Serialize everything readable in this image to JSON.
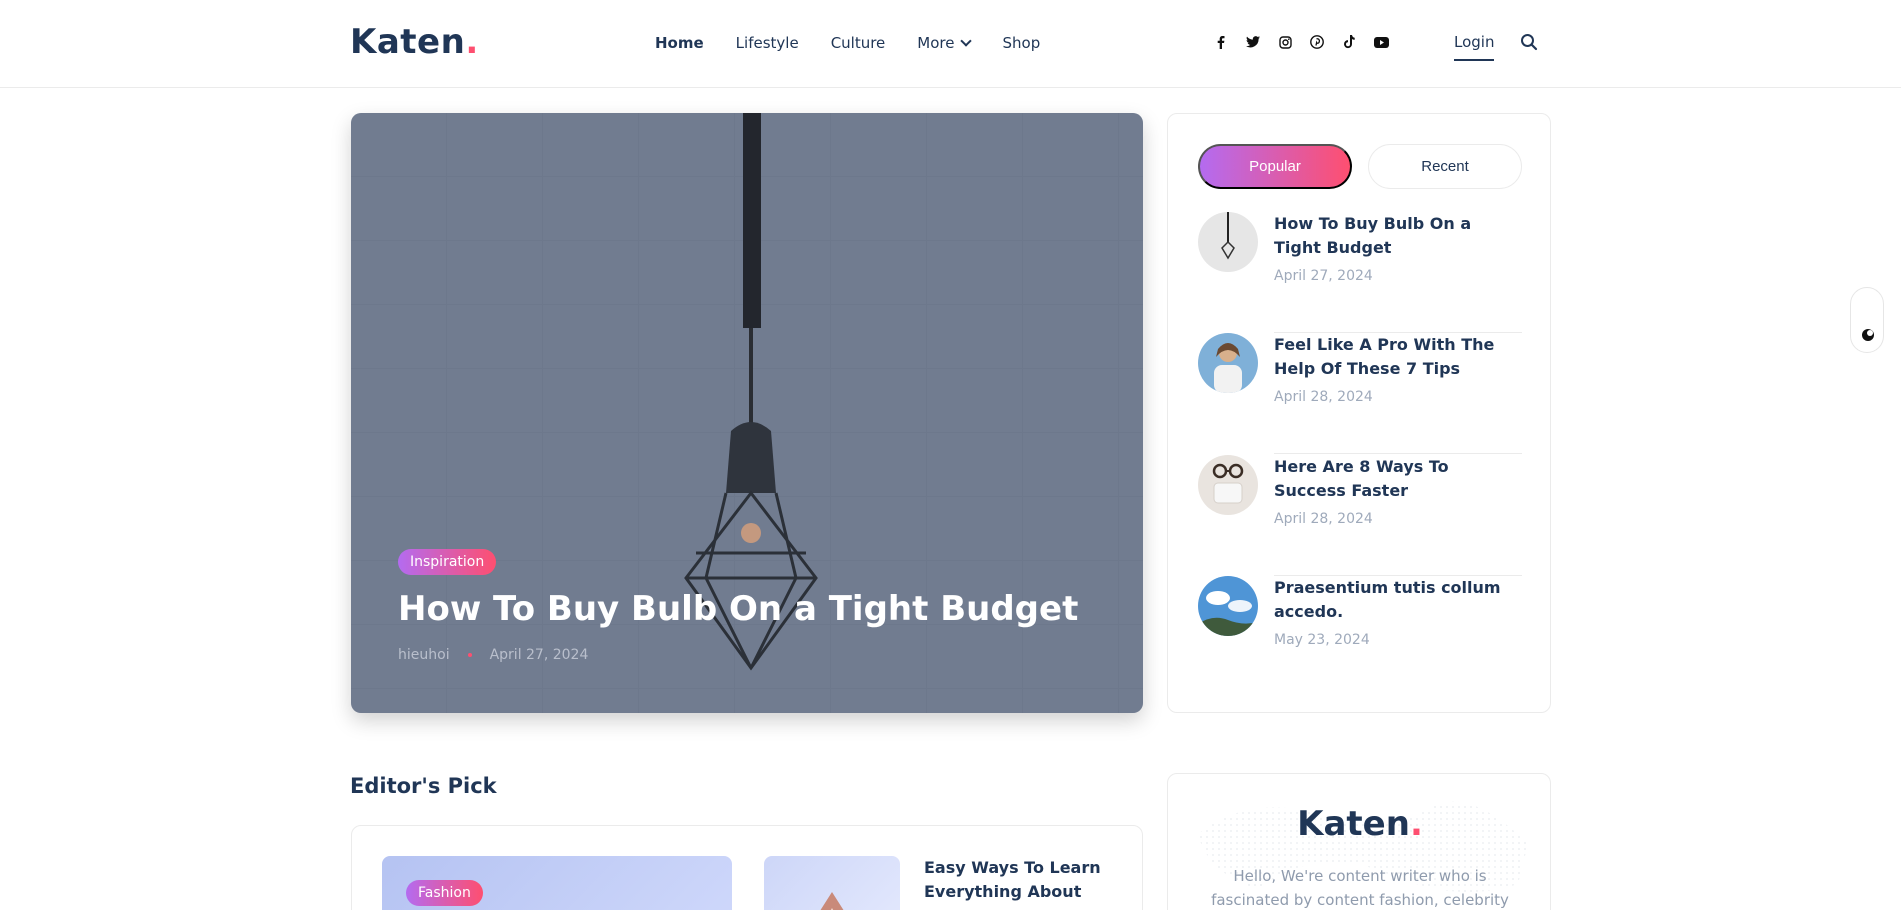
{
  "header": {
    "logo_text": "Katen",
    "logo_dot": ".",
    "nav": [
      "Home",
      "Lifestyle",
      "Culture",
      "More",
      "Shop"
    ],
    "social_icons": [
      "facebook-icon",
      "twitter-icon",
      "instagram-icon",
      "pinterest-icon",
      "tiktok-icon",
      "youtube-icon"
    ],
    "login_label": "Login"
  },
  "hero": {
    "category": "Inspiration",
    "title": "How To Buy Bulb On a Tight Budget",
    "author": "hieuhoi",
    "date": "April 27, 2024"
  },
  "sidebar": {
    "tabs": [
      "Popular",
      "Recent"
    ],
    "active_tab": "Popular",
    "posts": [
      {
        "title": "How To Buy Bulb On a Tight Budget",
        "date": "April 27, 2024"
      },
      {
        "title": "Feel Like A Pro With The Help Of These 7 Tips",
        "date": "April 28, 2024"
      },
      {
        "title": "Here Are 8 Ways To Success Faster",
        "date": "April 28, 2024"
      },
      {
        "title": "Praesentium tutis collum accedo.",
        "date": "May 23, 2024"
      }
    ]
  },
  "editors_pick": {
    "heading": "Editor's Pick",
    "first_category": "Fashion",
    "second_title": "Easy Ways To Learn Everything About"
  },
  "about": {
    "logo_text": "Katen",
    "logo_dot": ".",
    "text": "Hello, We're content writer who is fascinated by content fashion, celebrity"
  },
  "colors": {
    "brand_navy": "#203656",
    "accent_pink": "#fe4f70",
    "gradient_start": "#b46bf0"
  }
}
